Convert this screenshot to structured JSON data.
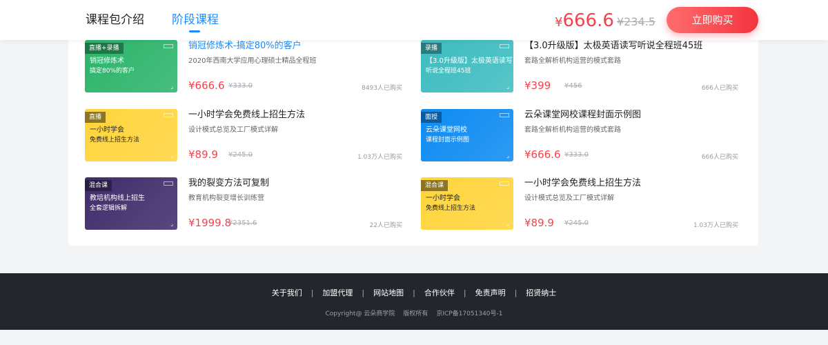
{
  "header": {
    "tabs": [
      "课程包介绍",
      "阶段课程"
    ],
    "price_currency": "¥",
    "price": "666.6",
    "original_price": "¥234.5",
    "buy_label": "立即购买"
  },
  "courses": [
    {
      "thumb": {
        "badge": "直播+录播",
        "line1": "销冠修炼术",
        "line2": "搞定80%的客户",
        "color": "#2bb46a",
        "dark": false
      },
      "title": "销冠修炼术-搞定80%的客户",
      "subtitle": "2020年西南大学应用心理硕士精品全程班",
      "price": "¥666.6",
      "original": "¥333.0",
      "buyers": "8493人已购买",
      "active": true
    },
    {
      "thumb": {
        "badge": "录播",
        "line1": "【3.0升级版】太极英语读写",
        "line2": "听说全程班45班",
        "color": "#3dbcc0",
        "dark": false
      },
      "title": "【3.0升级版】太极英语读写听说全程班45班",
      "subtitle": "套路全解析机构运营的模式套路",
      "price": "¥399",
      "original": "¥456",
      "buyers": "666人已购买",
      "active": false
    },
    {
      "thumb": {
        "badge": "直播",
        "line1": "一小时学会",
        "line2": "免费线上招生方法",
        "color": "#ffd43b",
        "dark": true
      },
      "title": "一小时学会免费线上招生方法",
      "subtitle": "设计模式总览及工厂模式详解",
      "price": "¥89.9",
      "original": "¥245.0",
      "buyers": "1.03万人已购买",
      "active": false
    },
    {
      "thumb": {
        "badge": "面授",
        "line1": "云朵课堂网校",
        "line2": "课程封面示例图",
        "color": "#0d8bf2",
        "dark": false
      },
      "title": "云朵课堂网校课程封面示例图",
      "subtitle": "套路全解析机构运营的模式套路",
      "price": "¥666.6",
      "original": "¥333.0",
      "buyers": "666人已购买",
      "active": false
    },
    {
      "thumb": {
        "badge": "混合课",
        "line1": "教培机构线上招生",
        "line2": "全套逻辑拆解",
        "color": "#3f2c6b",
        "dark": false
      },
      "title": "我的裂变方法可复制",
      "subtitle": "教育机构裂变增长训练营",
      "price": "¥1999.8",
      "original": "¥2351.6",
      "buyers": "22人已购买",
      "active": false
    },
    {
      "thumb": {
        "badge": "混合课",
        "line1": "一小时学会",
        "line2": "免费线上招生方法",
        "color": "#ffd43b",
        "dark": true
      },
      "title": "一小时学会免费线上招生方法",
      "subtitle": "设计模式总览及工厂模式详解",
      "price": "¥89.9",
      "original": "¥245.0",
      "buyers": "1.03万人已购买",
      "active": false
    }
  ],
  "footer": {
    "links": [
      "关于我们",
      "加盟代理",
      "网站地图",
      "合作伙伴",
      "免责声明",
      "招贤纳士"
    ],
    "separator": "|",
    "copyright": "Copyright@ 云朵商学院",
    "rights": "版权所有",
    "icp": "京ICP备17051340号-1"
  }
}
